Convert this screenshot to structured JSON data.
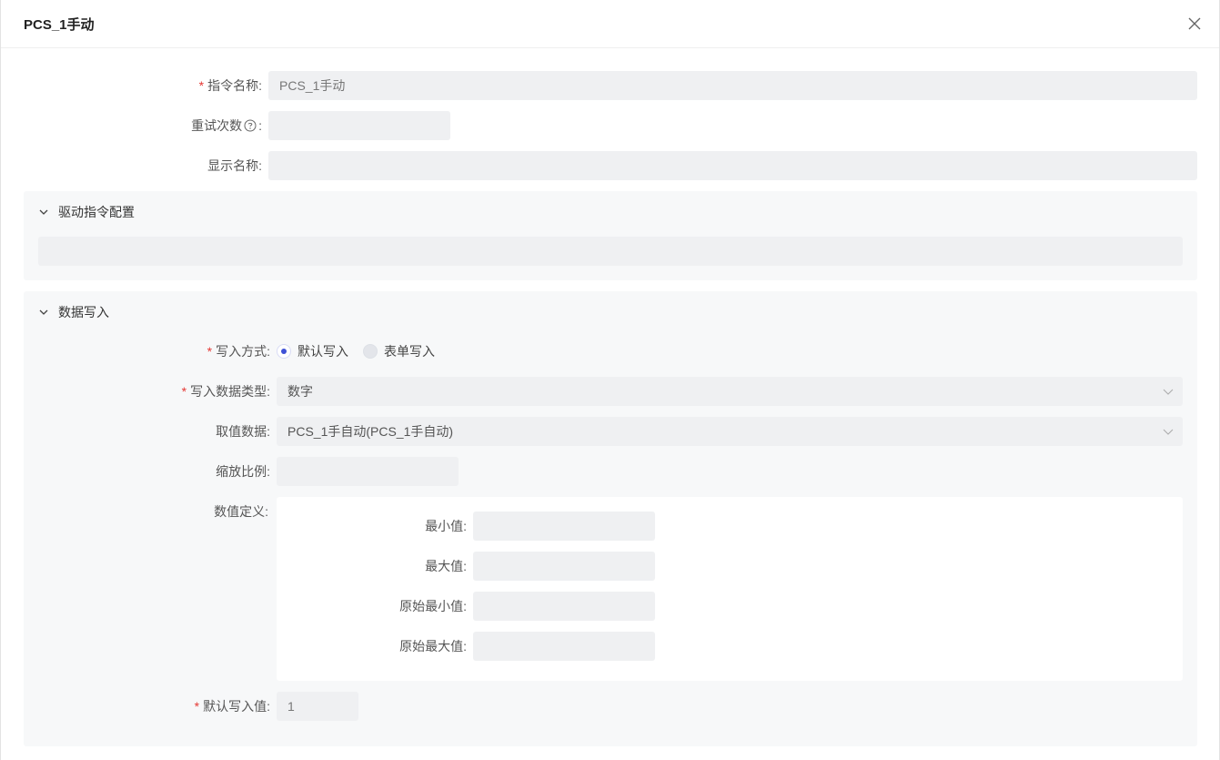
{
  "dialog": {
    "title": "PCS_1手动",
    "close_icon": "close-icon"
  },
  "form": {
    "command_name": {
      "label": "指令名称:",
      "required": "*",
      "value": "PCS_1手动"
    },
    "retry_count": {
      "label": "重试次数",
      "colon": ":",
      "help_icon": "question-circle-icon",
      "value": ""
    },
    "display_name": {
      "label": "显示名称:",
      "value": ""
    }
  },
  "driver_config": {
    "title": "驱动指令配置",
    "collapse_icon": "chevron-down-icon",
    "value": ""
  },
  "data_write": {
    "title": "数据写入",
    "collapse_icon": "chevron-down-icon",
    "write_mode": {
      "label": "写入方式:",
      "required": "*",
      "options": [
        {
          "label": "默认写入",
          "selected": true
        },
        {
          "label": "表单写入",
          "selected": false
        }
      ]
    },
    "data_type": {
      "label": "写入数据类型:",
      "required": "*",
      "value": "数字"
    },
    "source_data": {
      "label": "取值数据:",
      "value": "PCS_1手自动(PCS_1手自动)"
    },
    "scale": {
      "label": "缩放比例:",
      "value": ""
    },
    "value_def": {
      "label": "数值定义:",
      "min": {
        "label": "最小值:",
        "value": ""
      },
      "max": {
        "label": "最大值:",
        "value": ""
      },
      "raw_min": {
        "label": "原始最小值:",
        "value": ""
      },
      "raw_max": {
        "label": "原始最大值:",
        "value": ""
      }
    },
    "default_value": {
      "label": "默认写入值:",
      "required": "*",
      "value": "1"
    }
  },
  "colors": {
    "accent": "#3f51d6",
    "required": "#e53935",
    "input_bg": "#eff0f2",
    "panel_bg": "#f7f8f9"
  }
}
